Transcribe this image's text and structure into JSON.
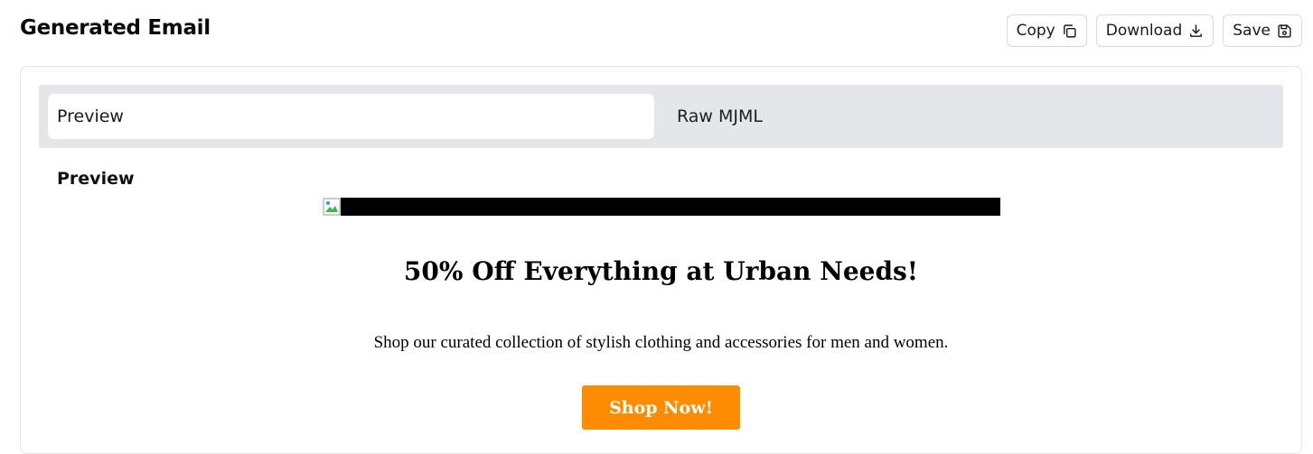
{
  "header": {
    "title": "Generated Email",
    "actions": {
      "copy_label": "Copy",
      "copy_icon": "copy-icon",
      "download_label": "Download",
      "download_icon": "download-icon",
      "save_label": "Save",
      "save_icon": "save-icon"
    }
  },
  "tabs": [
    {
      "label": "Preview",
      "active": true
    },
    {
      "label": "Raw MJML",
      "active": false
    }
  ],
  "preview": {
    "heading": "Preview",
    "email": {
      "image_icon": "broken-image-icon",
      "headline": "50% Off Everything at Urban Needs!",
      "body": "Shop our curated collection of stylish clothing and accessories for men and women.",
      "cta_label": "Shop Now!",
      "cta_color": "#ff8c00"
    }
  },
  "colors": {
    "tab_bar_bg": "#e5e6ea",
    "border": "#d9d9de"
  }
}
